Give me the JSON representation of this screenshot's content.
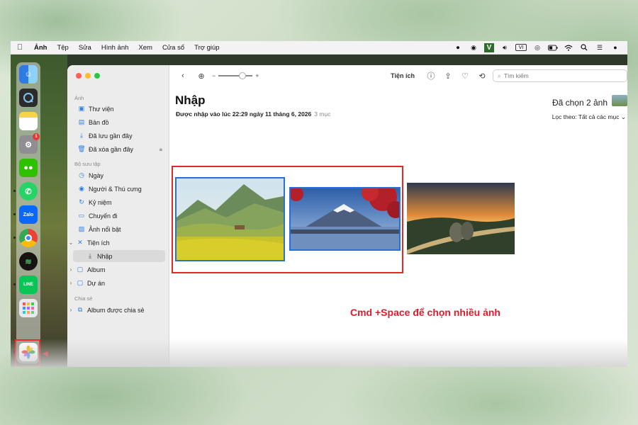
{
  "menubar": {
    "app_name": "Ảnh",
    "items": [
      "Tệp",
      "Sửa",
      "Hình ảnh",
      "Xem",
      "Cửa sổ",
      "Trợ giúp"
    ],
    "status_icons": [
      "record-icon",
      "line-icon",
      "v-app-icon",
      "volume-icon",
      "vi-input-icon",
      "airdrop-icon",
      "battery-icon",
      "wifi-icon",
      "search-icon",
      "control-center-icon",
      "siri-icon"
    ],
    "v_label": "V",
    "vi_label": "VI"
  },
  "dock": {
    "apps": [
      "Finder",
      "QuickTime",
      "Notes",
      "System Settings",
      "WeChat",
      "WhatsApp",
      "Zalo",
      "Chrome",
      "Spotify",
      "LINE",
      "Launchpad",
      "Photos"
    ],
    "zalo_label": "Zalo",
    "line_label": "LINE",
    "settings_badge": "1"
  },
  "sidebar": {
    "section_photos": "Ảnh",
    "library": "Thư viện",
    "map": "Bản đồ",
    "recently_saved": "Đã lưu gần đây",
    "recently_deleted": "Đã xóa gần đây",
    "section_collections": "Bộ sưu tập",
    "days": "Ngày",
    "people_pets": "Người & Thú cưng",
    "memories": "Kỷ niệm",
    "trips": "Chuyến đi",
    "featured": "Ảnh nổi bật",
    "utilities": "Tiện ích",
    "imports": "Nhập",
    "albums": "Album",
    "projects": "Dự án",
    "section_shared": "Chia sẻ",
    "shared_albums": "Album được chia sẻ"
  },
  "toolbar": {
    "zoom_minus": "−",
    "zoom_plus": "+",
    "utilities_label": "Tiện ích",
    "search_placeholder": "Tìm kiếm",
    "zoom_level": 0.7
  },
  "content": {
    "title": "Nhập",
    "subtitle": "Được nhập vào lúc 22:29 ngày 11 tháng 6, 2026",
    "item_count": "3 mục",
    "selected_count": "Đã chọn 2 ảnh",
    "filter": "Lọc theo: Tất cả các mục",
    "photos": [
      {
        "name": "rice-terraces-photo",
        "selected": true
      },
      {
        "name": "mount-fuji-photo",
        "selected": true
      },
      {
        "name": "golden-hands-bridge-photo",
        "selected": false
      }
    ]
  },
  "annotation": {
    "caption": "Cmd +Space để chọn nhiều ảnh"
  },
  "colors": {
    "accent_red": "#e0192d",
    "selection_blue": "#2a6fd6"
  }
}
